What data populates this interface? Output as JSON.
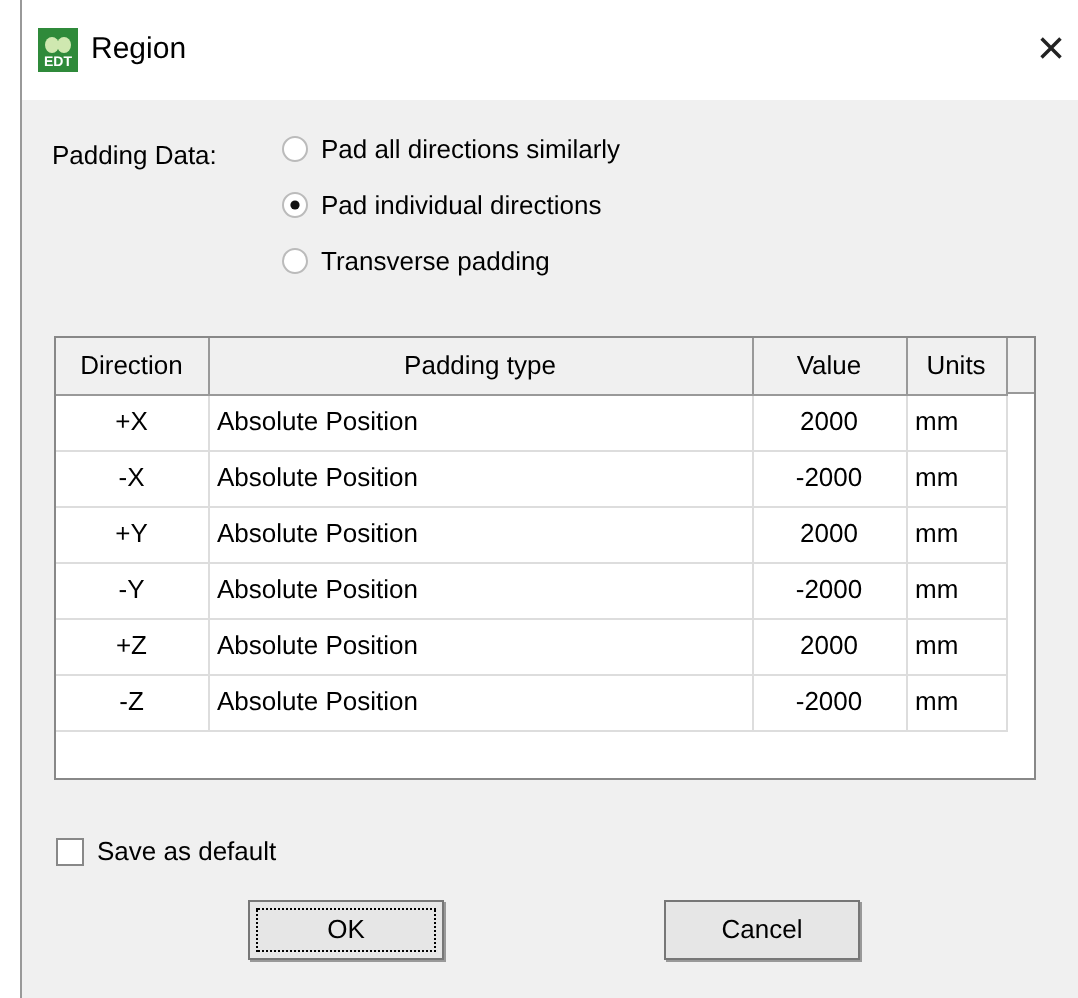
{
  "window": {
    "title": "Region",
    "icon_text": "EDT",
    "close": "×"
  },
  "padding_data": {
    "label": "Padding Data:",
    "options": [
      {
        "label": "Pad all directions similarly",
        "selected": false
      },
      {
        "label": "Pad individual directions",
        "selected": true
      },
      {
        "label": "Transverse padding",
        "selected": false
      }
    ]
  },
  "table": {
    "columns": [
      "Direction",
      "Padding type",
      "Value",
      "Units"
    ],
    "rows": [
      [
        "+X",
        "Absolute Position",
        "2000",
        "mm"
      ],
      [
        "-X",
        "Absolute Position",
        "-2000",
        "mm"
      ],
      [
        "+Y",
        "Absolute Position",
        "2000",
        "mm"
      ],
      [
        "-Y",
        "Absolute Position",
        "-2000",
        "mm"
      ],
      [
        "+Z",
        "Absolute Position",
        "2000",
        "mm"
      ],
      [
        "-Z",
        "Absolute Position",
        "-2000",
        "mm"
      ]
    ]
  },
  "save_default": {
    "label": "Save as default",
    "checked": false
  },
  "buttons": [
    {
      "label": "OK",
      "focused": true
    },
    {
      "label": "Cancel",
      "focused": false
    }
  ]
}
